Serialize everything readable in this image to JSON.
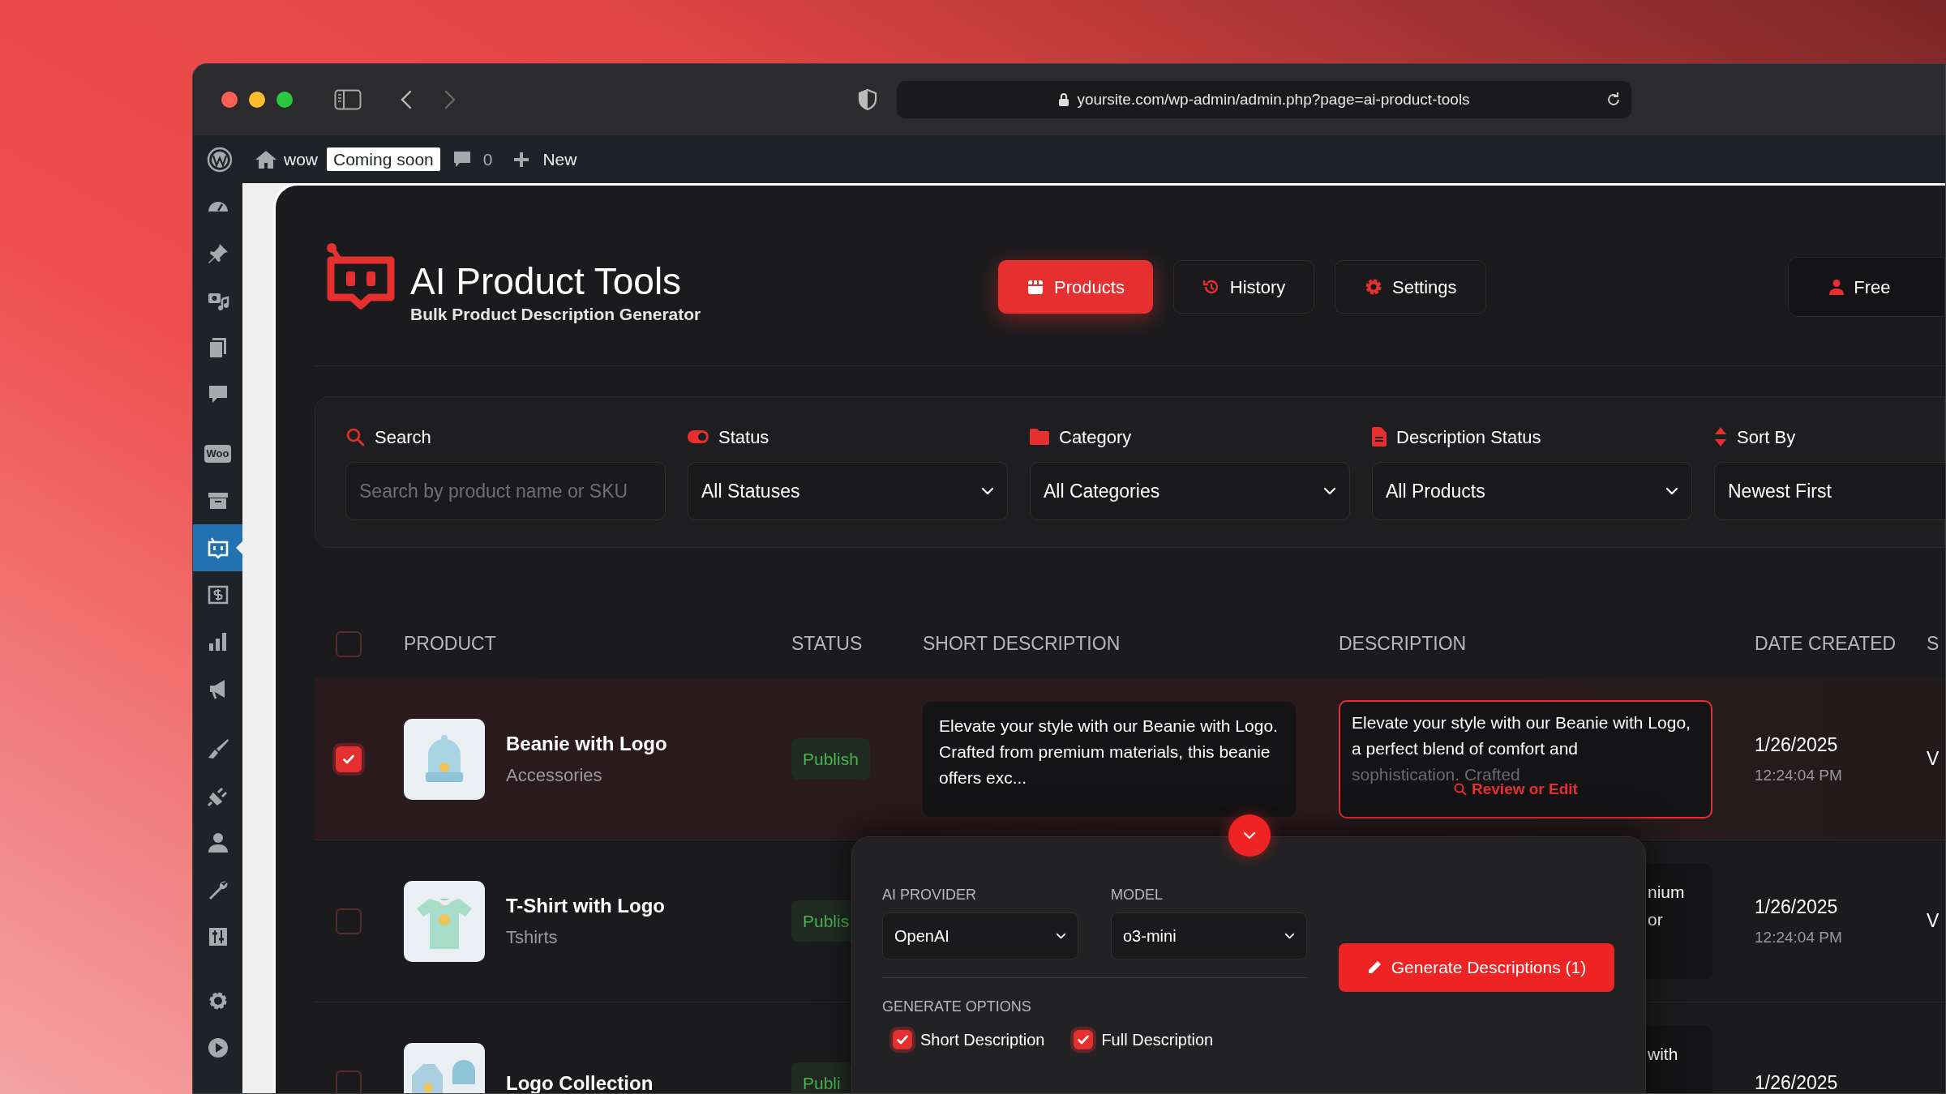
{
  "browser": {
    "url": "yoursite.com/wp-admin/admin.php?page=ai-product-tools"
  },
  "admin_bar": {
    "site": "wow",
    "badge": "Coming soon",
    "comments": "0",
    "new": "New"
  },
  "sidebar": {
    "items": [
      {
        "selected": false
      },
      {
        "selected": false
      },
      {
        "selected": false
      },
      {
        "selected": false
      },
      {
        "selected": false
      },
      {
        "selected": false,
        "icon_text": "Woo"
      },
      {
        "selected": false
      },
      {
        "selected": true
      },
      {
        "selected": false
      },
      {
        "selected": false
      },
      {
        "selected": false
      },
      {
        "selected": false
      },
      {
        "selected": false
      },
      {
        "selected": false
      },
      {
        "selected": false
      },
      {
        "selected": false
      },
      {
        "selected": false
      },
      {
        "selected": false
      }
    ]
  },
  "app": {
    "title": "AI Product Tools",
    "subtitle": "Bulk Product Description Generator",
    "nav": [
      {
        "label": "Products",
        "selected": true
      },
      {
        "label": "History",
        "selected": false
      },
      {
        "label": "Settings",
        "selected": false
      }
    ],
    "account_button": "Free"
  },
  "filters": [
    {
      "kind": "text",
      "label": "Search",
      "placeholder": "Search by product name or SKU"
    },
    {
      "kind": "select",
      "label": "Status",
      "value": "All Statuses"
    },
    {
      "kind": "select",
      "label": "Category",
      "value": "All Categories"
    },
    {
      "kind": "select",
      "label": "Description Status",
      "value": "All Products"
    },
    {
      "kind": "select",
      "label": "Sort By",
      "value": "Newest First"
    }
  ],
  "table": {
    "select_all": {
      "checked": false
    },
    "columns": [
      "PRODUCT",
      "STATUS",
      "SHORT DESCRIPTION",
      "DESCRIPTION",
      "DATE CREATED",
      "S"
    ],
    "rows": [
      {
        "checked": true,
        "selected": true,
        "name": "Beanie with Logo",
        "category": "Accessories",
        "status": "Publish",
        "short_description": "Elevate your style with our Beanie with Logo. Crafted from premium materials, this beanie offers exc...",
        "description": "Elevate your style with our Beanie with Logo, a perfect blend of comfort and",
        "description_faded": "sophistication. Crafted",
        "description_action": "Review or Edit",
        "date": "1/26/2025",
        "time": "12:24:04 PM",
        "column_7": "V"
      },
      {
        "checked": false,
        "selected": false,
        "name": "T-Shirt with Logo",
        "category": "Tshirts",
        "status": "Publis",
        "description_lines": [
          "nium",
          "or"
        ],
        "date": "1/26/2025",
        "time": "12:24:04 PM",
        "column_7": "V"
      },
      {
        "checked": false,
        "selected": false,
        "name": "Logo Collection",
        "status": "Publi",
        "description_lines": [
          "with"
        ],
        "date": "1/26/2025"
      }
    ]
  },
  "generate_panel": {
    "provider_label": "AI PROVIDER",
    "provider": "OpenAI",
    "model_label": "MODEL",
    "model": "o3-mini",
    "options_label": "GENERATE OPTIONS",
    "options": [
      {
        "label": "Short Description",
        "checked": true
      },
      {
        "label": "Full Description",
        "checked": true
      }
    ],
    "button": "Generate Descriptions (1)"
  }
}
